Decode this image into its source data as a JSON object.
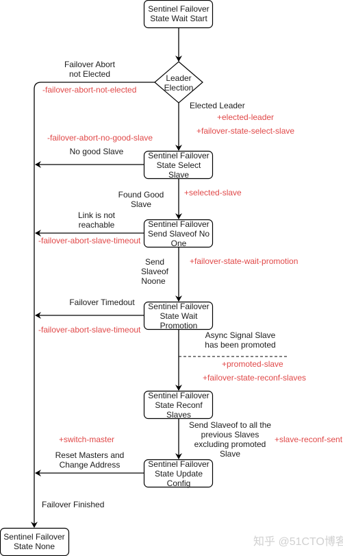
{
  "nodes": {
    "wait_start": [
      "Sentinel Failover",
      "State Wait Start"
    ],
    "leader_election": [
      "Leader",
      "Election"
    ],
    "select_slave": [
      "Sentinel Failover",
      "State Select",
      "Slave"
    ],
    "send_slaveof": [
      "Sentinel Failover",
      "Send Slaveof No",
      "One"
    ],
    "wait_promotion": [
      "Sentinel Failover",
      "State Wait",
      "Promotion"
    ],
    "reconf_slaves": [
      "Sentinel Failover",
      "State Reconf",
      "Slaves"
    ],
    "update_config": [
      "Sentinel Failover",
      "State Update",
      "Config"
    ],
    "state_none": [
      "Sentinel Failover",
      "State None"
    ]
  },
  "labels": {
    "abort_not_elected": [
      "Failover Abort",
      "not Elected"
    ],
    "elected_leader": "Elected Leader",
    "no_good_slave": "No good Slave",
    "found_good_slave": [
      "Found Good",
      "Slave"
    ],
    "link_not_reachable": [
      "Link is not",
      "reachable"
    ],
    "send_slaveof_noone": [
      "Send",
      "Slaveof",
      "Noone"
    ],
    "failover_timedout": "Failover Timedout",
    "async_signal": [
      "Async Signal Slave",
      "has been promoted"
    ],
    "send_slaveof_all": [
      "Send Slaveof to all the",
      "previous Slaves",
      "excluding promoted",
      "Slave"
    ],
    "reset_masters": [
      "Reset Masters and",
      "Change Address"
    ],
    "failover_finished": "Failover Finished"
  },
  "events": {
    "abort_not_elected": "-failover-abort-not-elected",
    "elected_leader": "+elected-leader",
    "state_select_slave": "+failover-state-select-slave",
    "abort_no_good_slave": "-failover-abort-no-good-slave",
    "selected_slave": "+selected-slave",
    "abort_slave_timeout_1": "-failover-abort-slave-timeout",
    "state_wait_promotion": "+failover-state-wait-promotion",
    "abort_slave_timeout_2": "-failover-abort-slave-timeout",
    "promoted_slave": "+promoted-slave",
    "state_reconf_slaves": "+failover-state-reconf-slaves",
    "switch_master": "+switch-master",
    "slave_reconf_sent": "+slave-reconf-sent"
  },
  "watermark": "知乎 @51CTO博客",
  "colors": {
    "event": "#e04848",
    "text": "#1a1a1a",
    "line": "#000000"
  }
}
